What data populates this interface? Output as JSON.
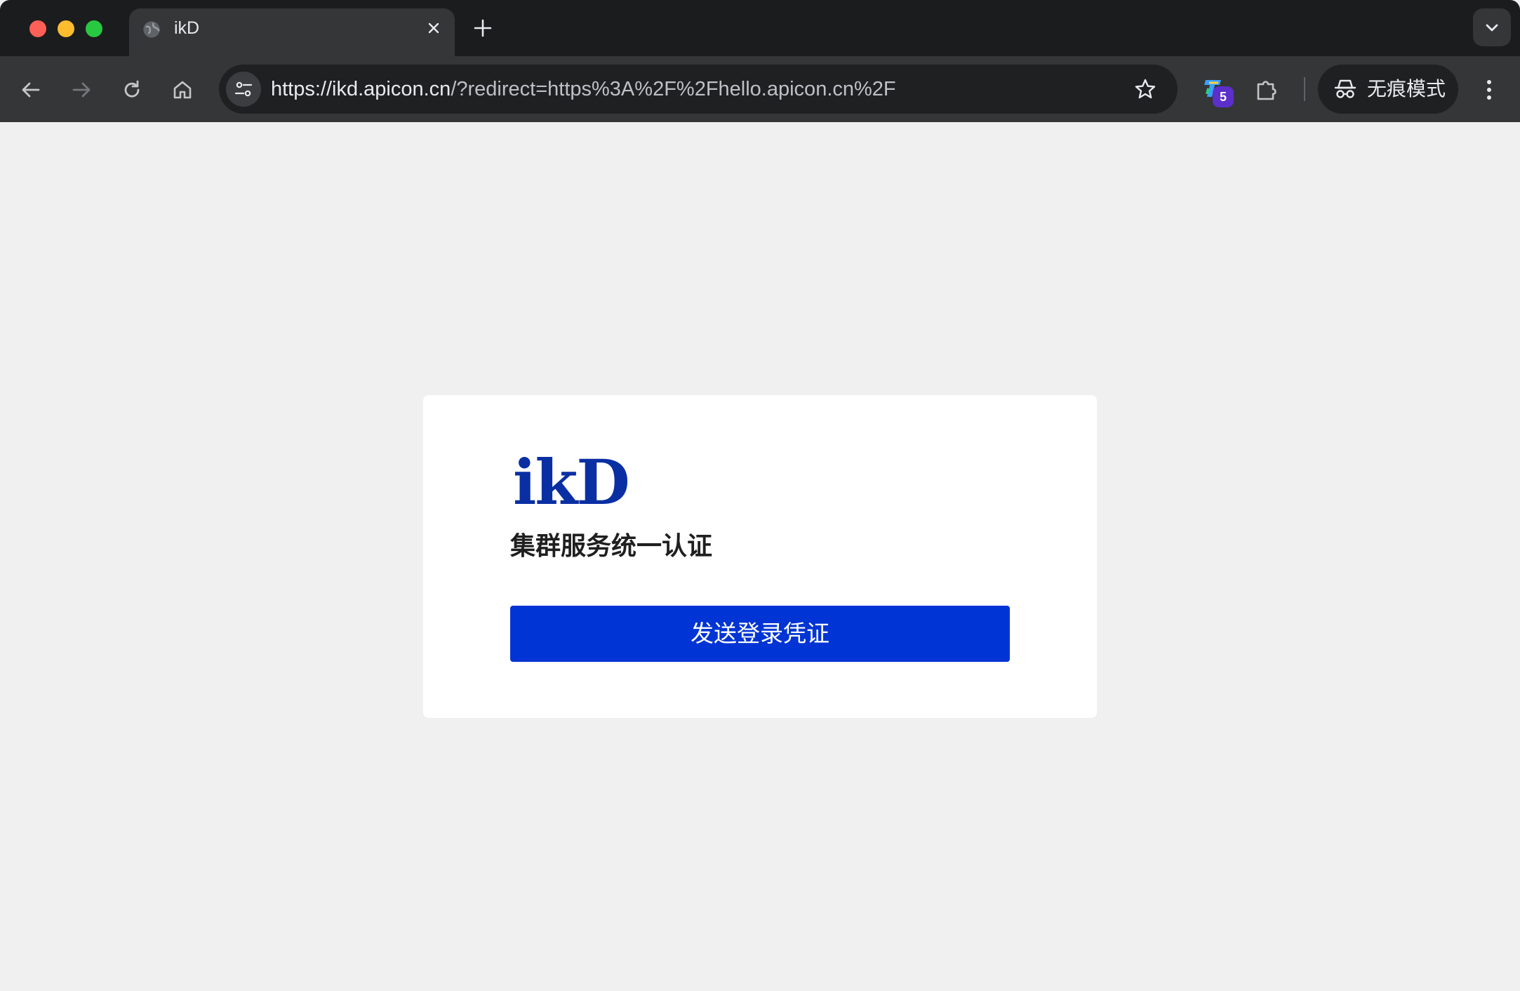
{
  "browser": {
    "tab": {
      "title": "ikD",
      "favicon": "globe-icon"
    },
    "new_tab_icon": "plus-icon",
    "tab_search_icon": "chevron-down-icon",
    "nav": {
      "back_icon": "arrow-left-icon",
      "forward_icon": "arrow-right-icon",
      "reload_icon": "reload-icon",
      "home_icon": "home-icon"
    },
    "omnibox": {
      "url_host": "https://ikd.apicon.cn",
      "url_rest": "/?redirect=https%3A%2F%2Fhello.apicon.cn%2F",
      "site_info_icon": "tune-icon",
      "bookmark_icon": "star-icon"
    },
    "extensions": {
      "ext_badge": "5",
      "puzzle_icon": "puzzle-icon"
    },
    "incognito": {
      "label": "无痕模式",
      "icon": "incognito-icon"
    },
    "menu_icon": "kebab-menu-icon"
  },
  "page": {
    "logo": "ikD",
    "heading": "集群服务统一认证",
    "primary_button": "发送登录凭证"
  },
  "colors": {
    "brand": "#0a2fa3",
    "button": "#0134d4",
    "page_bg": "#f0f0f0"
  }
}
